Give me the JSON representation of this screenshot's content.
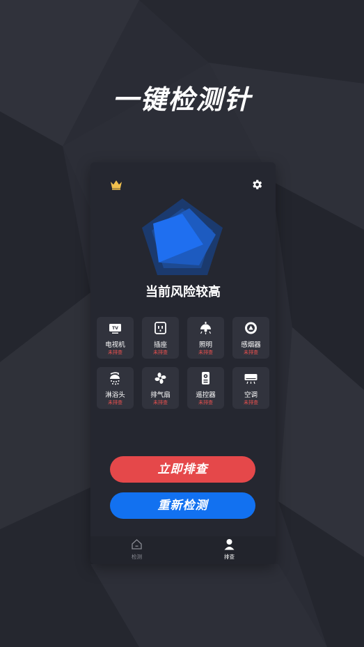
{
  "headline": "一键检测针",
  "header": {
    "crown_icon": "crown-icon",
    "settings_icon": "gear-icon"
  },
  "risk": {
    "title": "当前风险较高"
  },
  "devices": [
    {
      "name": "电视机",
      "status": "未排查",
      "icon": "tv-icon"
    },
    {
      "name": "插座",
      "status": "未排查",
      "icon": "socket-icon"
    },
    {
      "name": "照明",
      "status": "未排查",
      "icon": "lamp-icon"
    },
    {
      "name": "感烟器",
      "status": "未排查",
      "icon": "smoke-detector-icon"
    },
    {
      "name": "淋浴头",
      "status": "未排查",
      "icon": "shower-icon"
    },
    {
      "name": "排气扇",
      "status": "未排查",
      "icon": "fan-icon"
    },
    {
      "name": "遥控器",
      "status": "未排查",
      "icon": "remote-icon"
    },
    {
      "name": "空调",
      "status": "未排查",
      "icon": "air-conditioner-icon"
    }
  ],
  "actions": {
    "check_now": "立即排查",
    "redetect": "重新检测"
  },
  "tabs": [
    {
      "label": "检测",
      "icon": "home-icon",
      "active": false
    },
    {
      "label": "排查",
      "icon": "person-icon",
      "active": true
    }
  ],
  "colors": {
    "background": "#2a2c35",
    "panel": "#252730",
    "tile": "#31333d",
    "danger": "#e5484a",
    "primary": "#1271f0",
    "status_text": "#e8504f",
    "crown": "#f2c14e"
  }
}
